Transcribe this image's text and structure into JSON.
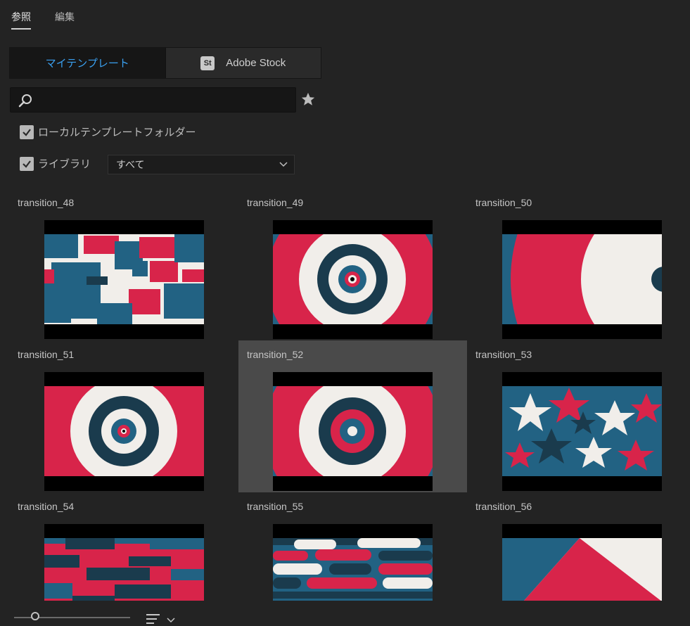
{
  "tabs": [
    {
      "label": "参照"
    },
    {
      "label": "編集"
    }
  ],
  "source_toggle": {
    "my_templates": "マイテンプレート",
    "stock_label": "Adobe Stock",
    "stock_badge": "St"
  },
  "search": {
    "value": "",
    "placeholder": ""
  },
  "filters": {
    "local_folder_label": "ローカルテンプレートフォルダー",
    "library_label": "ライブラリ",
    "library_select": "すべて"
  },
  "templates": [
    {
      "name": "transition_48"
    },
    {
      "name": "transition_49"
    },
    {
      "name": "transition_50"
    },
    {
      "name": "transition_51"
    },
    {
      "name": "transition_52"
    },
    {
      "name": "transition_53"
    },
    {
      "name": "transition_54"
    },
    {
      "name": "transition_55"
    },
    {
      "name": "transition_56"
    }
  ],
  "colors": {
    "accent": "#3aa0f0",
    "red": "#d8244a",
    "teal": "#226283",
    "navy": "#1a3b4d",
    "cream": "#f1eeea",
    "selected_bg": "#4a4a4a"
  }
}
